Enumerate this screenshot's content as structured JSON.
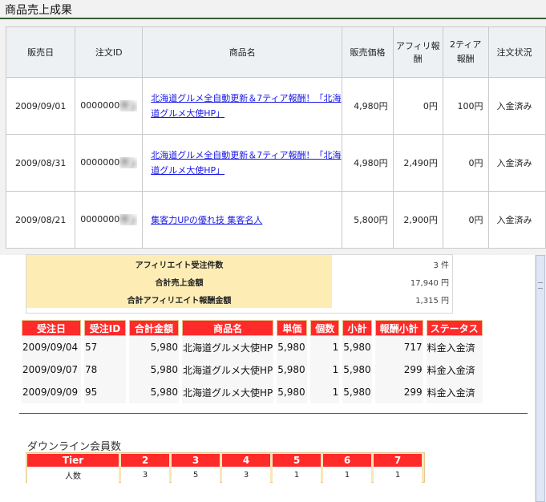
{
  "sales_section": {
    "title": "商品売上成果",
    "headers": [
      "販売日",
      "注文ID",
      "商品名",
      "販売価格",
      "アフィリ報酬",
      "2ティア報酬",
      "注文状況"
    ],
    "rows": [
      {
        "date": "2009/09/01",
        "order_id": "0000000",
        "product": "北海道グルメ全自動更新＆7ティア報酬！「北海道グルメ大使HP」",
        "price": "4,980円",
        "affiliate": "0円",
        "tier2": "100円",
        "status": "入金済み"
      },
      {
        "date": "2009/08/31",
        "order_id": "0000000",
        "product": "北海道グルメ全自動更新＆7ティア報酬！「北海道グルメ大使HP」",
        "price": "4,980円",
        "affiliate": "2,490円",
        "tier2": "0円",
        "status": "入金済み"
      },
      {
        "date": "2009/08/21",
        "order_id": "0000000",
        "product": "集客力UPの優れ技 集客名人",
        "price": "5,800円",
        "affiliate": "2,900円",
        "tier2": "0円",
        "status": "入金済み"
      }
    ]
  },
  "summary": {
    "rows": [
      {
        "label": "アフィリエイト受注件数",
        "value": "3 件"
      },
      {
        "label": "合計売上金額",
        "value": "17,940 円"
      },
      {
        "label": "合計アフィリエイト報酬金額",
        "value": "1,315 円"
      }
    ]
  },
  "orders": {
    "headers": [
      "受注日",
      "受注ID",
      "合計金額",
      "商品名",
      "単価",
      "個数",
      "小計",
      "報酬小計",
      "ステータス"
    ],
    "rows": [
      {
        "date": "2009/09/04",
        "id": "57",
        "total": "5,980",
        "product": "北海道グルメ大使HP",
        "unit": "5,980",
        "qty": "1",
        "subtotal": "5,980",
        "reward": "717",
        "status": "料金入金済"
      },
      {
        "date": "2009/09/07",
        "id": "78",
        "total": "5,980",
        "product": "北海道グルメ大使HP",
        "unit": "5,980",
        "qty": "1",
        "subtotal": "5,980",
        "reward": "299",
        "status": "料金入金済"
      },
      {
        "date": "2009/09/09",
        "id": "95",
        "total": "5,980",
        "product": "北海道グルメ大使HP",
        "unit": "5,980",
        "qty": "1",
        "subtotal": "5,980",
        "reward": "299",
        "status": "料金入金済"
      }
    ]
  },
  "downline": {
    "title": "ダウンライン会員数",
    "header_label": "Tier",
    "row_label": "人数",
    "tiers": [
      "2",
      "3",
      "4",
      "5",
      "6",
      "7"
    ],
    "counts": [
      "3",
      "5",
      "3",
      "1",
      "1",
      "1"
    ]
  }
}
